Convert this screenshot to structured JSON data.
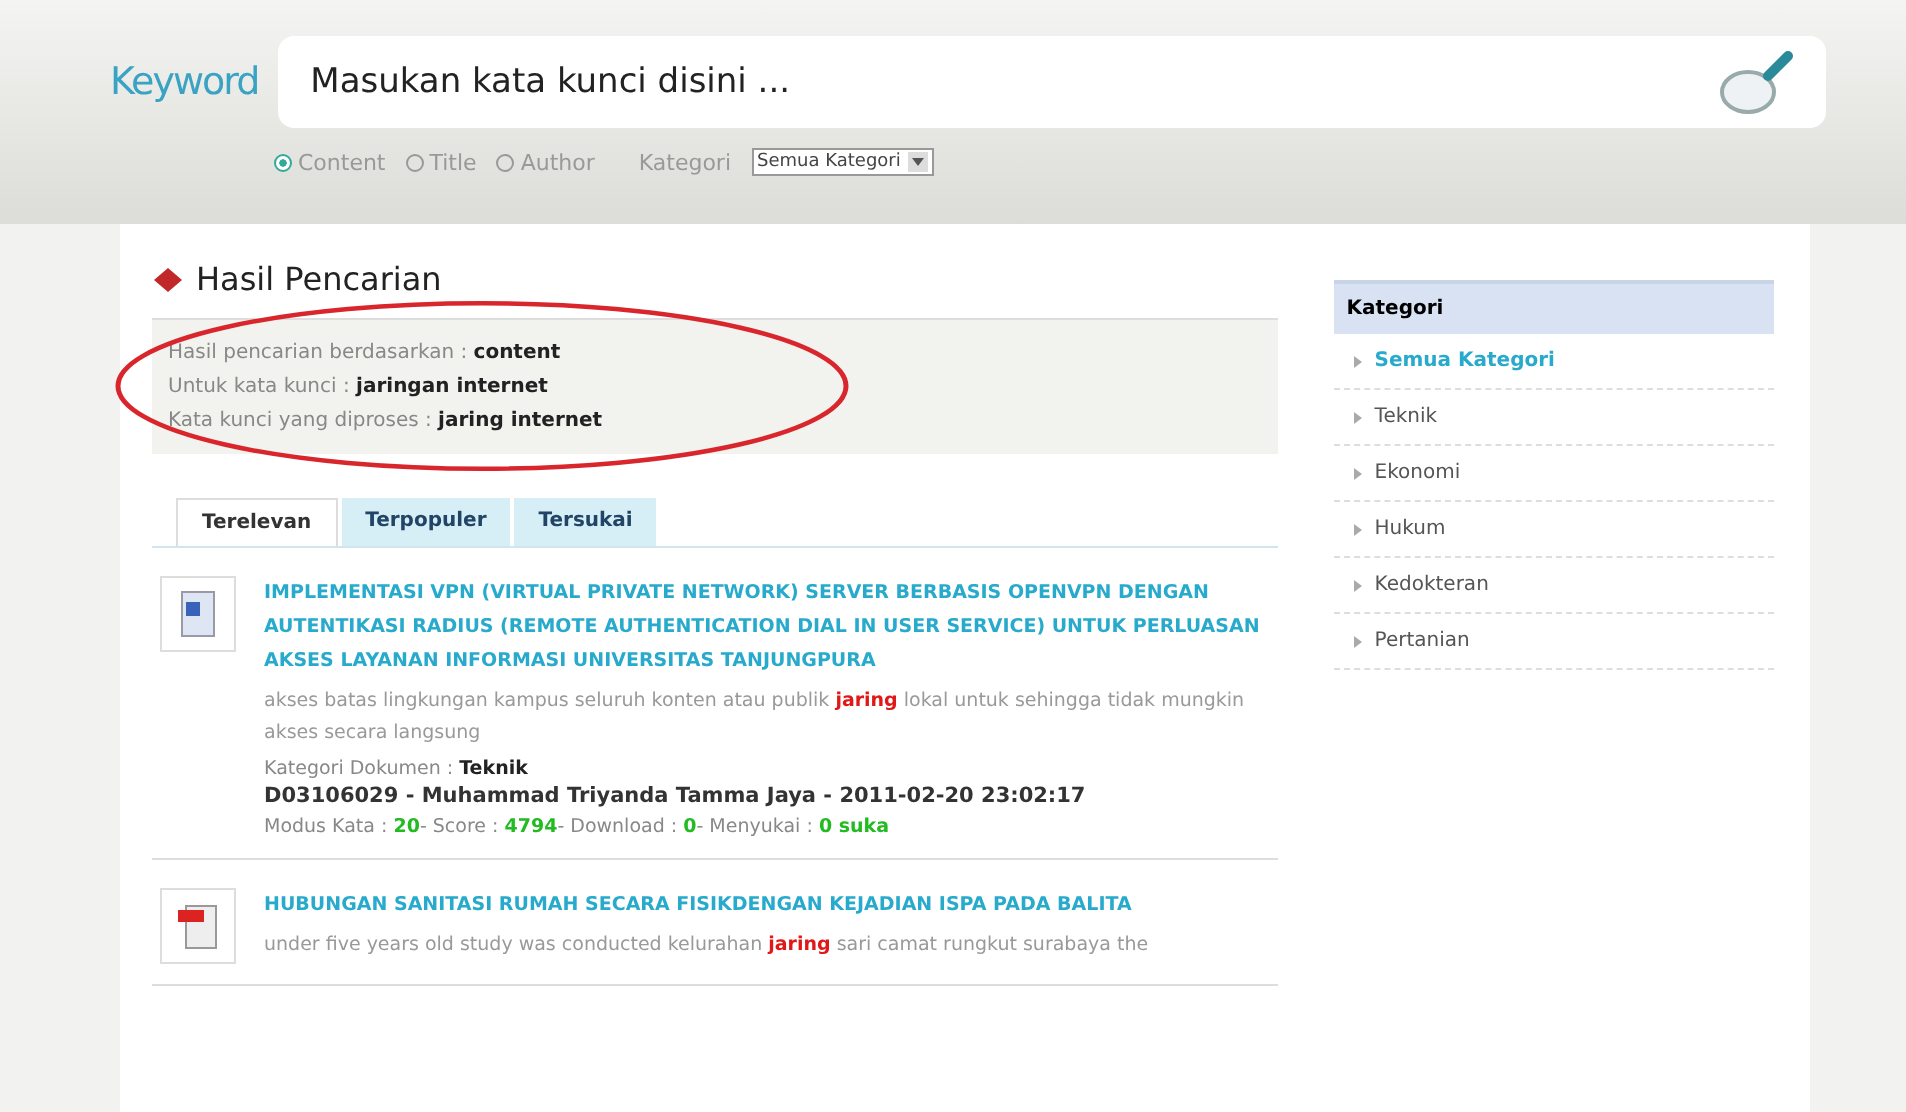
{
  "search": {
    "label": "Keyword",
    "placeholder": "Masukan kata kunci disini ...",
    "options": [
      {
        "label": "Content",
        "selected": true
      },
      {
        "label": "Title",
        "selected": false
      },
      {
        "label": "Author",
        "selected": false
      }
    ],
    "category_label": "Kategori",
    "category_value": "Semua Kategori"
  },
  "results": {
    "title": "Hasil Pencarian",
    "info": [
      {
        "label": "Hasil pencarian berdasarkan :",
        "value": "content"
      },
      {
        "label": "Untuk kata kunci :",
        "value": "jaringan internet"
      },
      {
        "label": "Kata kunci yang diproses :",
        "value": "jaring internet"
      }
    ],
    "tabs": [
      {
        "label": "Terelevan",
        "selected": true
      },
      {
        "label": "Terpopuler",
        "selected": false
      },
      {
        "label": "Tersukai",
        "selected": false
      }
    ],
    "items": [
      {
        "kind": "doc",
        "title": "IMPLEMENTASI VPN (VIRTUAL PRIVATE NETWORK) SERVER BERBASIS OPENVPN DENGAN AUTENTIKASI RADIUS (REMOTE AUTHENTICATION DIAL IN USER SERVICE) UNTUK PERLUASAN AKSES LAYANAN INFORMASI UNIVERSITAS TANJUNGPURA",
        "abstract": [
          "akses batas lingkungan kampus seluruh konten atau publik ",
          "jaring",
          " lokal untuk sehingga tidak mungkin akses secara langsung"
        ],
        "category_label": "Kategori Dokumen :",
        "category": "Teknik",
        "byline": "D03106029 - Muhammad Triyanda Tamma Jaya  -  2011-02-20 23:02:17",
        "stats": [
          {
            "label": "Modus Kata :",
            "value": "20"
          },
          {
            "label": "- Score :",
            "value": "4794"
          },
          {
            "label": "- Download :",
            "value": "0"
          },
          {
            "label": "- Menyukai :",
            "value": "0 suka"
          }
        ]
      },
      {
        "kind": "pdf",
        "title": "HUBUNGAN SANITASI RUMAH SECARA FISIKDENGAN KEJADIAN ISPA PADA BALITA",
        "abstract": [
          "under five years old study was conducted kelurahan ",
          "jaring",
          " sari camat rungkut surabaya the"
        ]
      }
    ]
  },
  "sidebar": {
    "title": "Kategori",
    "items": [
      {
        "label": "Semua Kategori",
        "selected": true
      },
      {
        "label": "Teknik",
        "selected": false
      },
      {
        "label": "Ekonomi",
        "selected": false
      },
      {
        "label": "Hukum",
        "selected": false
      },
      {
        "label": "Kedokteran",
        "selected": false
      },
      {
        "label": "Pertanian",
        "selected": false
      }
    ]
  }
}
